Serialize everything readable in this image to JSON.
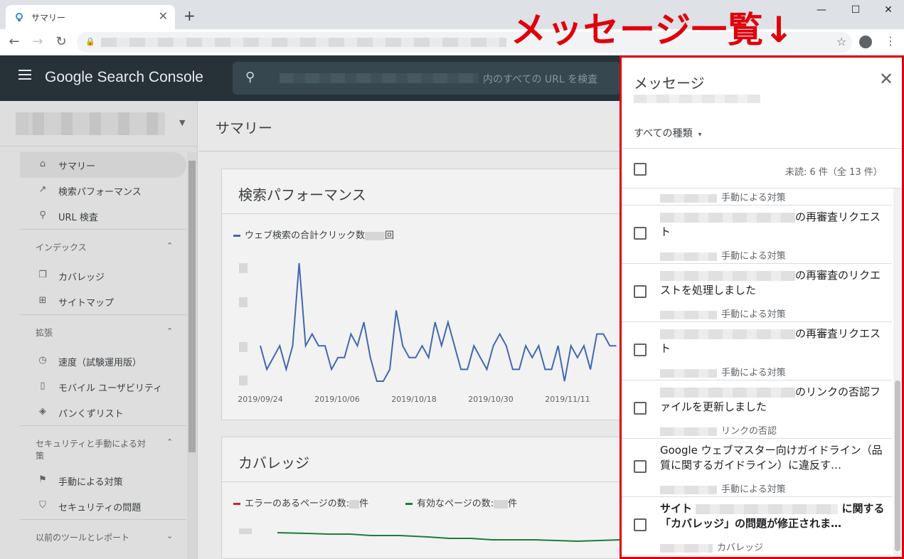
{
  "browser": {
    "tab_title": "サマリー",
    "tab_close": "✕",
    "new_tab": "+",
    "win_min": "—",
    "win_max": "☐",
    "win_close": "✕",
    "back": "←",
    "forward": "→",
    "reload": "↻",
    "lock": "🔒",
    "star": "☆",
    "kebab": "⋮"
  },
  "app": {
    "logo": "Google Search Console",
    "search_placeholder": "内のすべての URL を検査"
  },
  "sidebar": {
    "items": [
      {
        "icon": "home-icon",
        "glyph": "⌂",
        "label": "サマリー",
        "active": true
      },
      {
        "icon": "trending-icon",
        "glyph": "↗",
        "label": "検索パフォーマンス"
      },
      {
        "icon": "search-icon",
        "glyph": "⚲",
        "label": "URL 検査"
      }
    ],
    "section_index": "インデックス",
    "index_items": [
      {
        "icon": "coverage-icon",
        "glyph": "❐",
        "label": "カバレッジ"
      },
      {
        "icon": "sitemap-icon",
        "glyph": "⊞",
        "label": "サイトマップ"
      }
    ],
    "section_enhancements": "拡張",
    "enh_items": [
      {
        "icon": "speed-icon",
        "glyph": "◷",
        "label": "速度（試験運用版）"
      },
      {
        "icon": "mobile-icon",
        "glyph": "▯",
        "label": "モバイル ユーザビリティ"
      },
      {
        "icon": "breadcrumb-icon",
        "glyph": "◈",
        "label": "パンくずリスト"
      }
    ],
    "section_security": "セキュリティと手動による対策",
    "sec_items": [
      {
        "icon": "flag-icon",
        "glyph": "⚑",
        "label": "手動による対策"
      },
      {
        "icon": "shield-icon",
        "glyph": "⛉",
        "label": "セキュリティの問題"
      }
    ],
    "section_legacy": "以前のツールとレポート",
    "caret_up": "⌃",
    "caret_down": "⌄"
  },
  "main": {
    "page_title": "サマリー",
    "perf_card_title": "検索パフォーマンス",
    "perf_legend_prefix": "ウェブ検索の合計クリック数",
    "perf_legend_suffix": "回",
    "coverage_card_title": "カバレッジ",
    "cov_legend_error_prefix": "エラーのあるページの数:",
    "cov_legend_error_suffix": "件",
    "cov_legend_valid_prefix": "有効なページの数:",
    "cov_legend_valid_suffix": "件",
    "colors": {
      "clicks": "#4267b2",
      "error": "#c62828",
      "valid": "#1e7b3b"
    }
  },
  "chart_data": {
    "type": "line",
    "x_tick_labels": [
      "2019/09/24",
      "2019/10/06",
      "2019/10/18",
      "2019/10/30",
      "2019/11/11"
    ],
    "series": [
      {
        "name": "ウェブ検索の合計クリック数",
        "values": [
          3,
          1,
          2,
          3,
          1,
          3,
          10,
          3,
          4,
          3,
          3,
          1,
          2,
          2,
          4,
          3,
          5,
          2,
          0,
          0,
          1,
          6,
          3,
          2,
          2,
          3,
          2,
          5,
          3,
          5,
          3,
          1,
          1,
          3,
          2,
          1,
          3,
          4,
          3,
          1,
          1,
          3,
          2,
          3,
          1,
          1,
          3,
          0,
          3,
          2,
          3,
          1,
          4,
          4,
          3,
          3,
          4
        ]
      }
    ],
    "ylim": [
      0,
      10
    ]
  },
  "messages": {
    "title": "メッセージ",
    "close": "✕",
    "filter": "すべての種類",
    "filter_caret": "▾",
    "unread": "未読: 6 件（全 13 件）",
    "items": [
      {
        "title": "",
        "meta": "手動による対策",
        "bold": false
      },
      {
        "title": "の再審査リクエスト",
        "meta": "手動による対策",
        "bold": false
      },
      {
        "title": "の再審査のリクエストを処理しました",
        "meta": "手動による対策",
        "bold": false
      },
      {
        "title": "の再審査リクエスト",
        "meta": "手動による対策",
        "bold": false
      },
      {
        "title": "のリンクの否認ファイルを更新しました",
        "meta": "リンクの否認",
        "bold": false
      },
      {
        "title": "Google ウェブマスター向けガイドライン（品質に関するガイドライン）に違反す…",
        "meta": "手動による対策",
        "bold": false
      },
      {
        "title_prefix": "サイト",
        "title": "に関する「カバレッジ」の問題が修正されま…",
        "meta": "カバレッジ",
        "bold": true
      }
    ]
  },
  "annotation": "メッセージ一覧↓"
}
